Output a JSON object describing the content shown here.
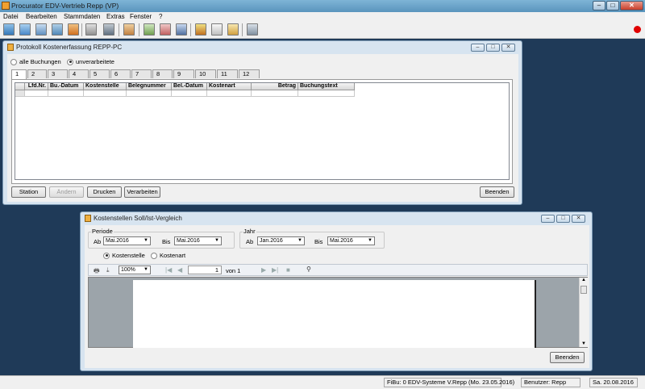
{
  "app": {
    "title": "Procurator EDV-Vertrieb Repp (VP)"
  },
  "menu": [
    "Datei",
    "Bearbeiten",
    "Stammdaten",
    "Extras",
    "Fenster",
    "?"
  ],
  "protokoll": {
    "title": "Protokoll Kostenerfassung REPP-PC",
    "filter_all": "alle Buchungen",
    "filter_unprocessed": "unverarbeitete",
    "tabs": [
      "1",
      "2",
      "3",
      "4",
      "5",
      "6",
      "7",
      "8",
      "9",
      "10",
      "11",
      "12"
    ],
    "columns": [
      "Lfd.Nr.",
      "Bu.-Datum",
      "Kostenstelle",
      "Belegnummer",
      "Bel.-Datum",
      "Kostenart",
      "Betrag",
      "Buchungstext"
    ],
    "buttons": {
      "station": "Station",
      "aendern": "Ändern",
      "drucken": "Drucken",
      "verarbeiten": "Verarbeiten",
      "beenden": "Beenden"
    }
  },
  "sollist": {
    "title": "Kostenstellen Soll/Ist-Vergleich",
    "periode_label": "Periode",
    "jahr_label": "Jahr",
    "ab": "Ab",
    "bis": "Bis",
    "periode_ab": "Mai.2016",
    "periode_bis": "Mai.2016",
    "jahr_ab": "Jan.2016",
    "jahr_bis": "Mai.2016",
    "opt_kostenstelle": "Kostenstelle",
    "opt_kostenart": "Kostenart",
    "zoom": "100%",
    "page": "1",
    "page_of": "von 1",
    "beenden": "Beenden"
  },
  "status": {
    "fibu": "FiBu: 0 EDV-Systeme V.Repp (Mo. 23.05.2016)",
    "user": "Benutzer: Repp",
    "date": "Sa. 20.08.2016"
  }
}
